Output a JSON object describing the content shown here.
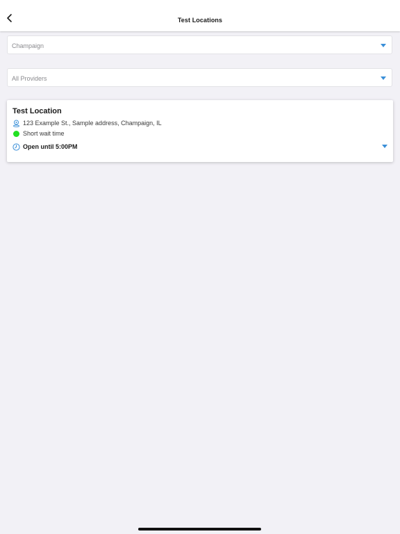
{
  "header": {
    "title": "Test Locations",
    "back_icon": "chevron-left-icon"
  },
  "filters": {
    "city": {
      "selected": "Champaign",
      "icon": "caret-down-icon"
    },
    "provider": {
      "selected": "All Providers",
      "icon": "caret-down-icon"
    }
  },
  "locations": [
    {
      "name": "Test Location",
      "address": "123 Example St., Sample address, Champaign, IL",
      "wait_status": "Short wait time",
      "hours": "Open until 5:00PM"
    }
  ],
  "colors": {
    "accent": "#3a8fd8",
    "wait_short": "#22e022",
    "background": "#f2f1f6"
  }
}
